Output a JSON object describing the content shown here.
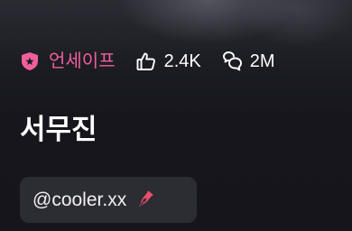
{
  "stats": {
    "safety_label": "언세이프",
    "likes": "2.4K",
    "chats": "2M"
  },
  "profile": {
    "name": "서무진",
    "handle": "@cooler.xx"
  },
  "colors": {
    "accent_pink": "#ef5f9a",
    "pen_red": "#e8506a",
    "background": "#15151b",
    "chip": "#2c2c33"
  },
  "icons": {
    "safety": "shield-star-icon",
    "likes": "thumbs-up-icon",
    "chats": "chat-bubbles-icon",
    "creator": "pen-nib-icon"
  }
}
